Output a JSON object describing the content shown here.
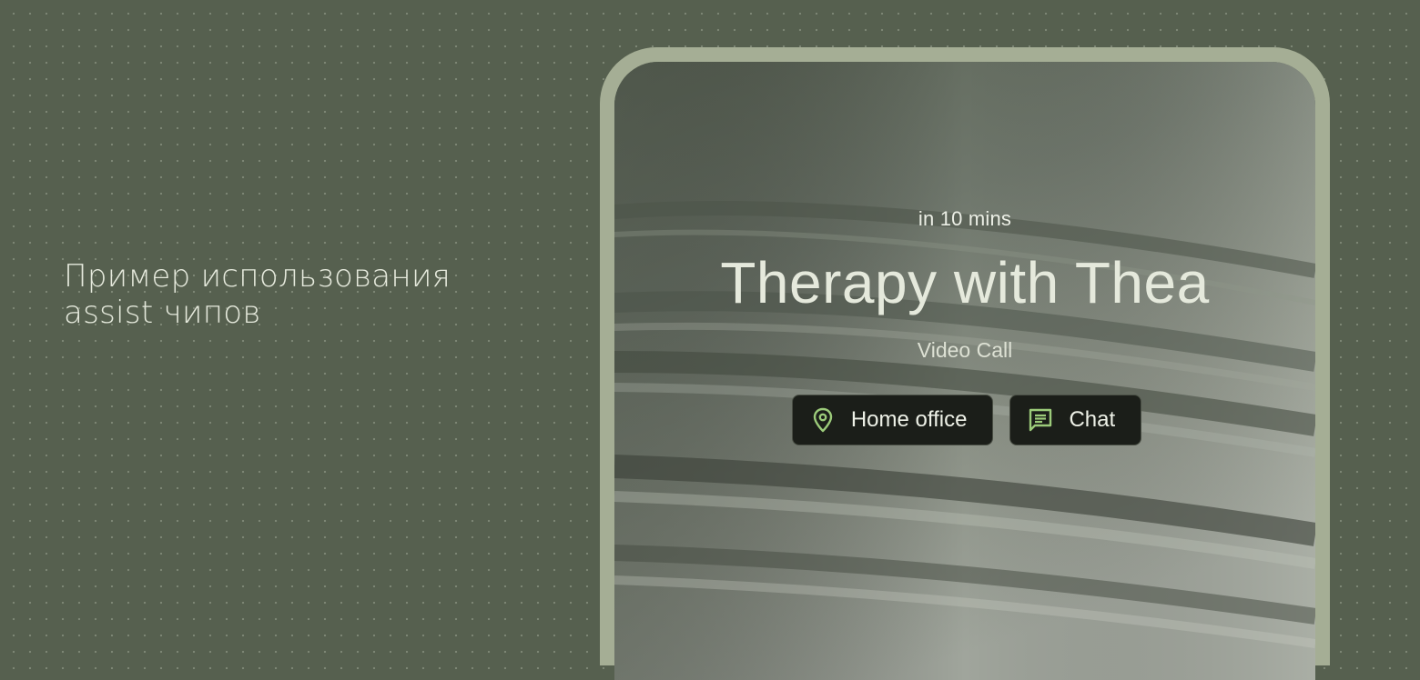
{
  "caption": {
    "line1": "Пример использования",
    "line2": "assist чипов"
  },
  "event": {
    "time": "in 10 mins",
    "title": "Therapy with Thea",
    "type": "Video Call"
  },
  "chips": [
    {
      "label": "Home office",
      "icon": "location-pin-icon"
    },
    {
      "label": "Chat",
      "icon": "chat-message-icon"
    }
  ],
  "colors": {
    "background": "#56604f",
    "device_frame": "#a5ae95",
    "chip_background": "#1b1e19",
    "icon_accent": "#9ccb7a"
  }
}
